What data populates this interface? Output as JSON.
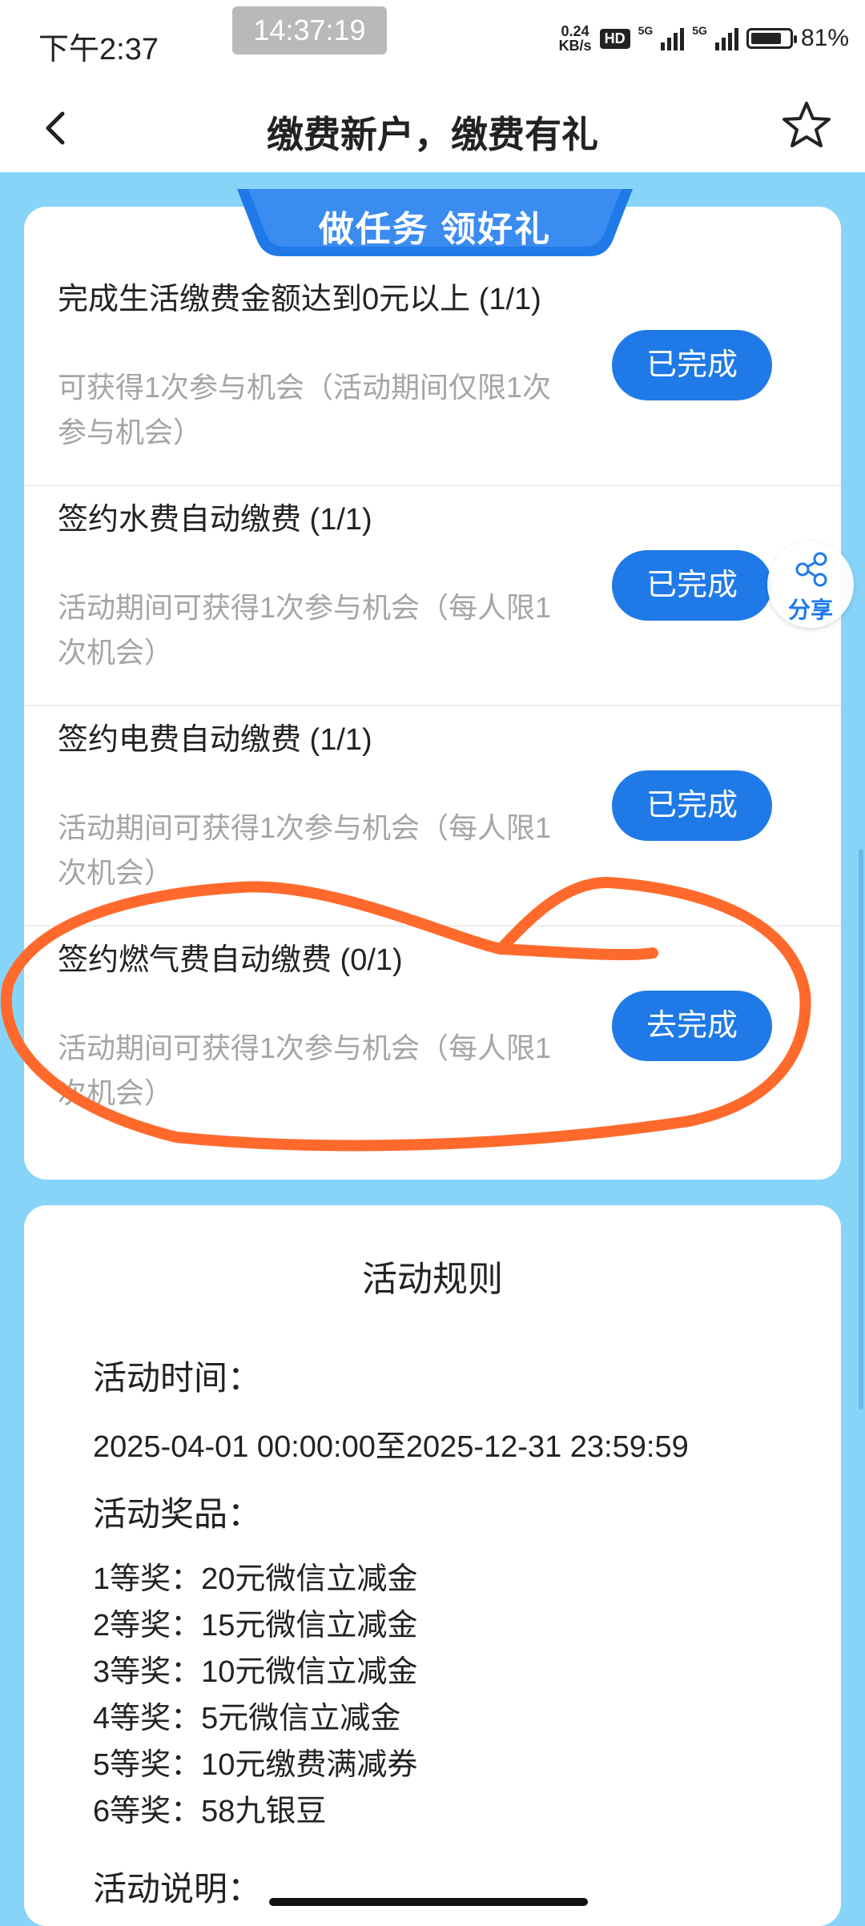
{
  "status_bar": {
    "time": "下午2:37",
    "clock_overlay": "14:37:19",
    "net_speed": "0.24",
    "net_speed_unit": "KB/s",
    "hd_badge": "HD",
    "network_1": "5G",
    "network_2": "5G",
    "battery": "81%",
    "battery_level": 0.81
  },
  "header": {
    "title": "缴费新户，缴费有礼",
    "back_icon": "back-arrow-icon",
    "star_icon": "star-outline-icon"
  },
  "banner": {
    "text": "做任务 领好礼"
  },
  "tasks": [
    {
      "title": "完成生活缴费金额达到0元以上 (1/1)",
      "desc": "可获得1次参与机会（活动期间仅限1次参与机会）",
      "button": "已完成"
    },
    {
      "title": "签约水费自动缴费 (1/1)",
      "desc": "活动期间可获得1次参与机会（每人限1次机会）",
      "button": "已完成"
    },
    {
      "title": "签约电费自动缴费 (1/1)",
      "desc": "活动期间可获得1次参与机会（每人限1次机会）",
      "button": "已完成"
    },
    {
      "title": "签约燃气费自动缴费 (0/1)",
      "desc": "活动期间可获得1次参与机会（每人限1次机会）",
      "button": "去完成"
    }
  ],
  "share": {
    "label": "分享",
    "icon": "share-icon"
  },
  "rules": {
    "title": "活动规则",
    "time_label": "活动时间：",
    "time_value": "2025-04-01 00:00:00至2025-12-31 23:59:59",
    "prize_label": "活动奖品：",
    "prizes": [
      "1等奖：20元微信立减金",
      "2等奖：15元微信立减金",
      "3等奖：10元微信立减金",
      "4等奖：5元微信立减金",
      "5等奖：10元缴费满减券",
      "6等奖：58九银豆"
    ],
    "desc_label": "活动说明："
  },
  "colors": {
    "page_bg": "#87d4f8",
    "primary": "#1f7ae8",
    "annotation": "#ff6a2c"
  }
}
